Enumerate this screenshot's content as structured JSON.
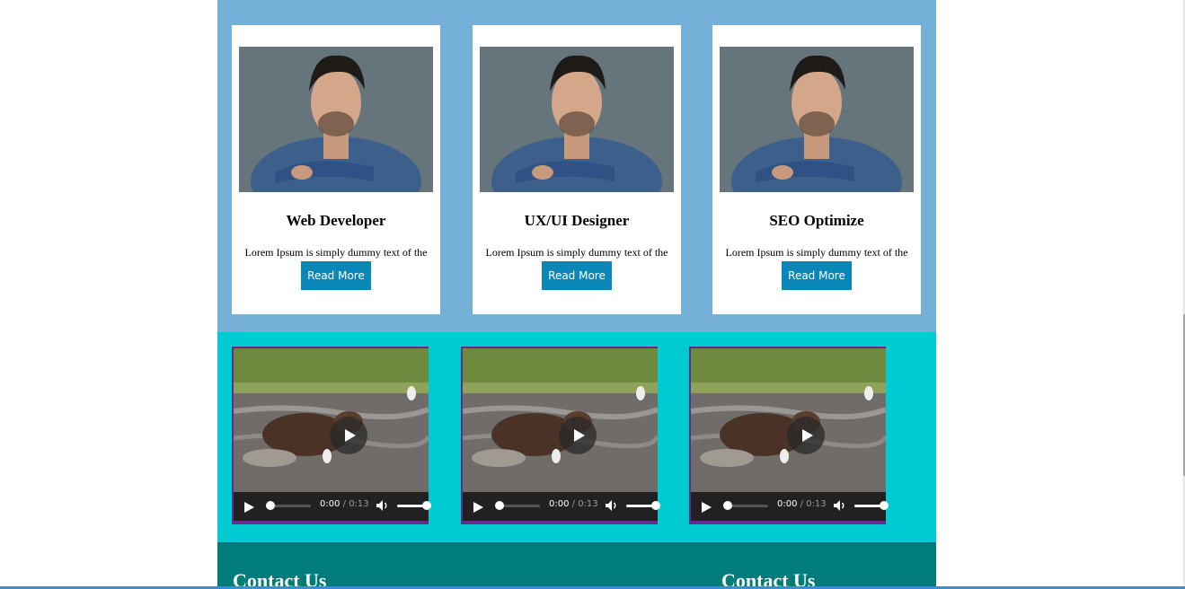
{
  "cards": [
    {
      "title": "Web Developer",
      "text": "Lorem Ipsum is simply dummy text of the",
      "button": "Read More"
    },
    {
      "title": "UX/UI Designer",
      "text": "Lorem Ipsum is simply dummy text of the",
      "button": "Read More"
    },
    {
      "title": "SEO Optimize",
      "text": "Lorem Ipsum is simply dummy text of the",
      "button": "Read More"
    }
  ],
  "videos": [
    {
      "current": "0:00",
      "duration": " / 0:13",
      "progress": 0,
      "volume": 1.0
    },
    {
      "current": "0:00",
      "duration": " / 0:13",
      "progress": 0,
      "volume": 1.0
    },
    {
      "current": "0:00",
      "duration": " / 0:13",
      "progress": 0,
      "volume": 1.0
    }
  ],
  "contact": {
    "left_heading": "Contact Us",
    "right_heading": "Contact Us"
  },
  "colors": {
    "cards_bg": "#74b0d8",
    "videos_bg": "#00cbd3",
    "contact_bg": "#007c7c",
    "button_bg": "#0a86b8",
    "video_border": "#6a2a8c"
  },
  "icons": [
    "play-icon",
    "volume-icon",
    "big-play-icon"
  ]
}
